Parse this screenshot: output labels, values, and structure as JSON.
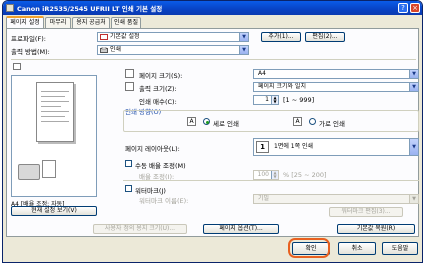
{
  "window": {
    "title": "Canon iR2535/2545 UFRII LT 인쇄 기본 설정",
    "help_glyph": "?",
    "close_glyph": "×"
  },
  "tabs": [
    "페이지 설정",
    "마무리",
    "용지 공급처",
    "인쇄 품질"
  ],
  "profile": {
    "label": "프로파일(F):",
    "value": "기본값 설정",
    "add_label": "추가(1)...",
    "edit_label": "편집(2)..."
  },
  "output": {
    "label": "출력 방법(M):",
    "value": "인쇄"
  },
  "preview": {
    "status": "A4 [배율 조정: 자동]",
    "view_settings_label": "현재 설정 보기(V)"
  },
  "page_size": {
    "label": "페이지 크기(S):",
    "value": "A4"
  },
  "output_size": {
    "label": "출력 크기(Z):",
    "value": "페이지 크기와 일치"
  },
  "copies": {
    "label": "인쇄 매수(C):",
    "value": "1",
    "range": "[1 ~ 999]"
  },
  "orientation": {
    "label": "인쇄 방향(O)",
    "portrait": "세로 인쇄",
    "landscape": "가로 인쇄",
    "portrait_glyph": "A",
    "landscape_glyph": "A"
  },
  "layout": {
    "label": "페이지 레이아웃(L):",
    "value": "1면에 1쪽 인쇄",
    "icon_glyph": "1"
  },
  "manual_scaling": {
    "label": "수동 배율 조정(M)",
    "scale_label": "배율 조정(I):",
    "scale_value": "100",
    "scale_range": "% [25 ~ 200]"
  },
  "watermark": {
    "label": "워터마크(J)",
    "name_label": "워터마크 이름(E):",
    "name_value": "기밀",
    "edit_label": "워터마크 편집(3)..."
  },
  "footer_buttons": {
    "custom_size": "사용자 정의 용지 크기(U)...",
    "page_options": "페이지 옵션(T)...",
    "restore": "기본값 복원(R)"
  },
  "dialog_buttons": {
    "ok": "확인",
    "cancel": "취소",
    "help": "도움말"
  },
  "colors": {
    "title_bar": "#0842c4",
    "highlight": "#e8601f",
    "tab_accent": "#f1a12c"
  }
}
